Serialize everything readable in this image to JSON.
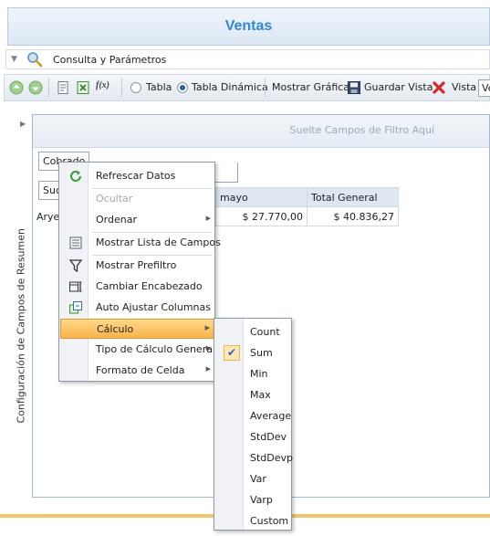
{
  "header": {
    "title": "Ventas"
  },
  "query_bar": {
    "label": "Consulta y Parámetros"
  },
  "toolbar": {
    "radio_tabla": "Tabla",
    "radio_tabla_dinamica": "Tabla Dinámica",
    "selected_view": "Tabla Dinámica",
    "mostrar_grafica": "Mostrar Gráfica",
    "guardar_vista": "Guardar Vista",
    "vista_label": "Vista",
    "vista_value": "Ve"
  },
  "side_panel": {
    "label": "Configuración de Campos de Resumen"
  },
  "pivot": {
    "filter_hint": "Suelte Campos de Filtro Aquí",
    "field_cobrado": "Cobrado",
    "field_suc": "Suc",
    "col_headers": [
      "mayo",
      "Total General"
    ],
    "row_label": "Arye",
    "row_values": [
      "$ 27.770,00",
      "$ 40.836,27"
    ]
  },
  "context_menu": {
    "items": [
      {
        "label": "Refrescar Datos",
        "icon": "refresh-icon"
      },
      {
        "label": "Ocultar",
        "disabled": true
      },
      {
        "label": "Ordenar",
        "submenu": true
      },
      {
        "label": "Mostrar Lista de Campos",
        "icon": "field-list-icon"
      },
      {
        "label": "Mostrar Prefiltro",
        "icon": "filter-icon"
      },
      {
        "label": "Cambiar Encabezado",
        "icon": "header-icon"
      },
      {
        "label": "Auto Ajustar Columnas",
        "icon": "autofit-icon"
      },
      {
        "label": "Cálculo",
        "submenu": true,
        "highlighted": true
      },
      {
        "label": "Tipo de Cálculo General",
        "submenu": true
      },
      {
        "label": "Formato de Celda",
        "submenu": true
      }
    ]
  },
  "calc_submenu": {
    "items": [
      "Count",
      "Sum",
      "Min",
      "Max",
      "Average",
      "StdDev",
      "StdDevp",
      "Var",
      "Varp",
      "Custom"
    ],
    "checked": "Sum"
  },
  "colors": {
    "title": "#2f86d3",
    "highlight": "#f9b34b",
    "accent_line": "#f2c36b"
  }
}
